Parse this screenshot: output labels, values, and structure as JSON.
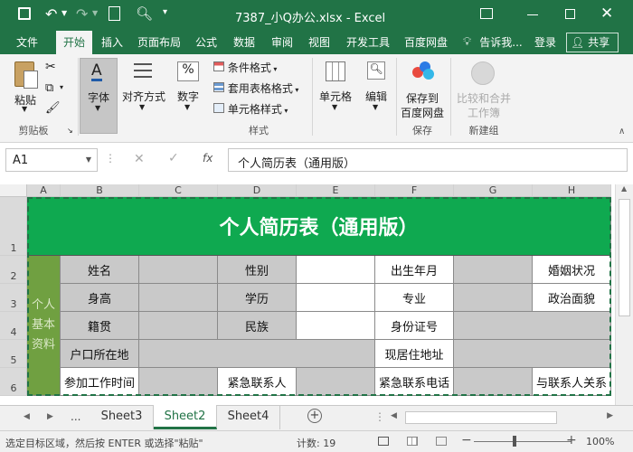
{
  "titlebar": {
    "title": "7387_小Q办公.xlsx - Excel"
  },
  "tabs": [
    "文件",
    "开始",
    "插入",
    "页面布局",
    "公式",
    "数据",
    "审阅",
    "视图",
    "开发工具",
    "百度网盘"
  ],
  "tell_me": "告诉我...",
  "login": "登录",
  "share": "共享",
  "ribbon": {
    "paste": "粘贴",
    "clipboard": "剪贴板",
    "font": "字体",
    "align": "对齐方式",
    "number": "数字",
    "number_symbol": "%",
    "cond_format": "条件格式",
    "table_format": "套用表格格式",
    "cell_style": "单元格样式",
    "style_group": "样式",
    "cells": "单元格",
    "edit": "编辑",
    "save_baidu_1": "保存到",
    "save_baidu_2": "百度网盘",
    "save_group": "保存",
    "compare_1": "比较和合并",
    "compare_2": "工作簿",
    "new_group": "新建组"
  },
  "formula_bar": {
    "name_box": "A1",
    "fx": "fx",
    "content": "个人简历表（通用版）"
  },
  "columns": [
    "A",
    "B",
    "C",
    "D",
    "E",
    "F",
    "G",
    "H"
  ],
  "rows": [
    "1",
    "2",
    "3",
    "4",
    "5",
    "6"
  ],
  "sheet": {
    "title": "个人简历表（通用版）",
    "side_label": "个人\n基本\n资料",
    "labels": {
      "name": "姓名",
      "gender": "性别",
      "birth": "出生年月",
      "marital": "婚姻状况",
      "height": "身高",
      "education": "学历",
      "major": "专业",
      "political": "政治面貌",
      "native": "籍贯",
      "ethnic": "民族",
      "id": "身份证号",
      "hukou": "户口所在地",
      "address": "现居住地址",
      "work_date": "参加工作时间",
      "contact": "紧急联系人",
      "contact_phone": "紧急联系电话",
      "relation": "与联系人关系"
    }
  },
  "sheet_tabs": [
    "Sheet3",
    "Sheet2",
    "Sheet4"
  ],
  "sheet_tab_more": "...",
  "status": {
    "message": "选定目标区域，然后按 ENTER 或选择\"粘贴\"",
    "count": "计数: 19",
    "zoom": "100%"
  },
  "colors": {
    "excel_green": "#217346",
    "title_green": "#0fa950",
    "side_green": "#70a041"
  }
}
